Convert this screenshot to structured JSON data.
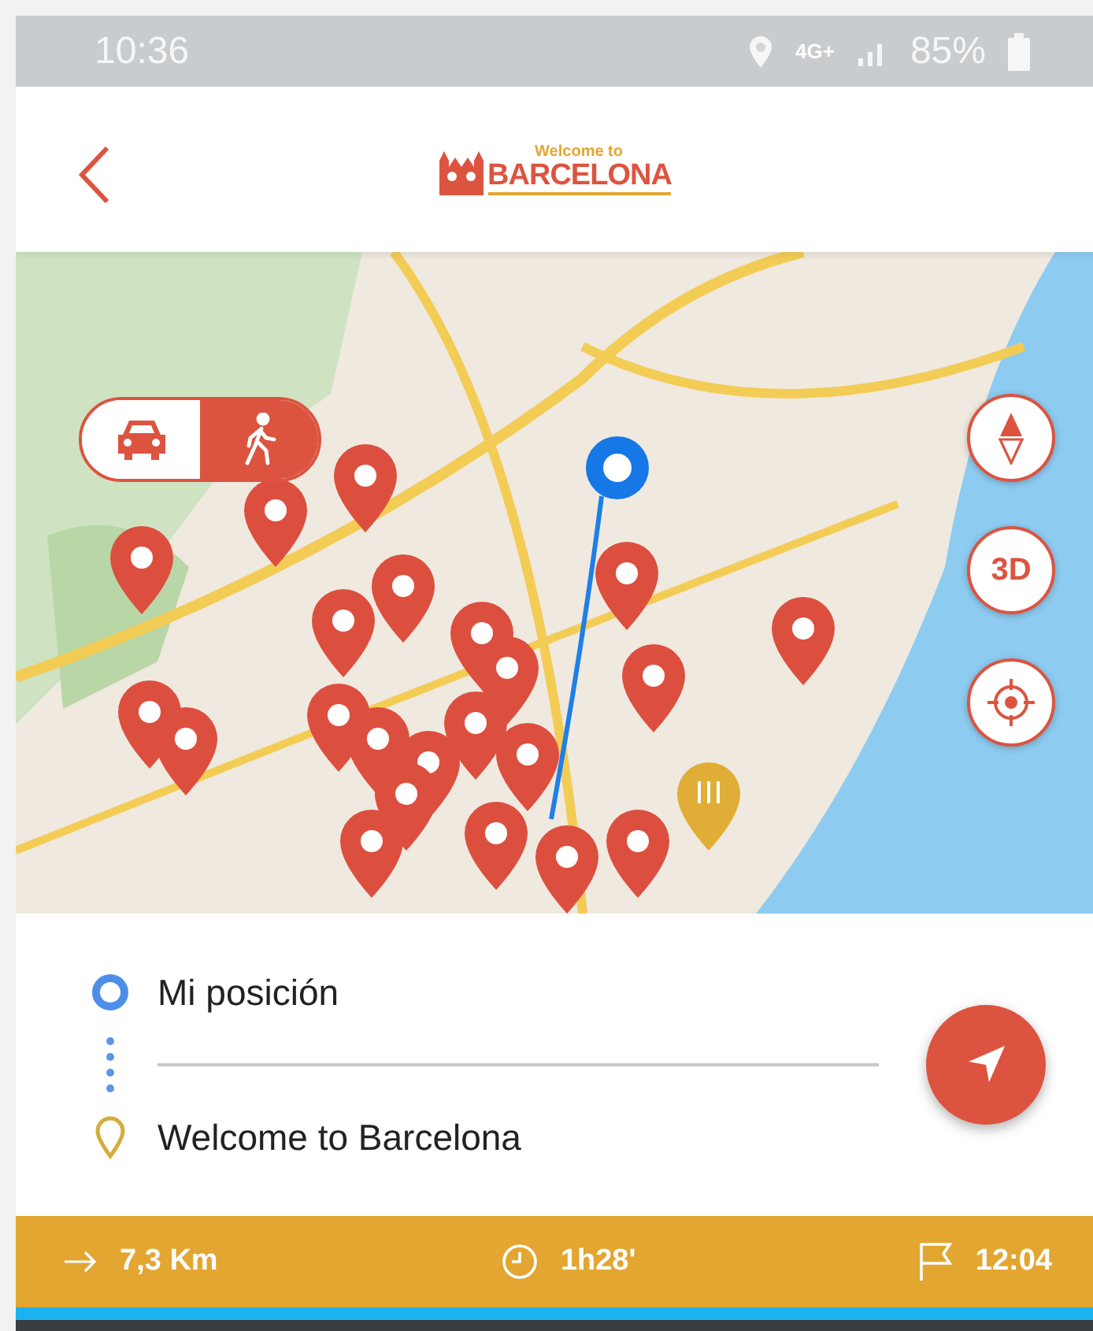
{
  "status_bar": {
    "time": "10:36",
    "network": "4G+",
    "battery": "85%"
  },
  "header": {
    "logo_line_1": "Welcome to",
    "logo_line_2": "BARCELONA"
  },
  "travel_modes": [
    {
      "kind": "car",
      "selected": false
    },
    {
      "kind": "walk",
      "selected": true
    }
  ],
  "map_buttons": [
    {
      "kind": "compass"
    },
    {
      "kind": "text",
      "label": "3D"
    },
    {
      "kind": "locate"
    }
  ],
  "route": {
    "origin": "Mi posición",
    "destination": "Welcome to Barcelona"
  },
  "summary": {
    "distance": "7,3 Km",
    "duration": "1h28'",
    "arrival": "12:04"
  }
}
